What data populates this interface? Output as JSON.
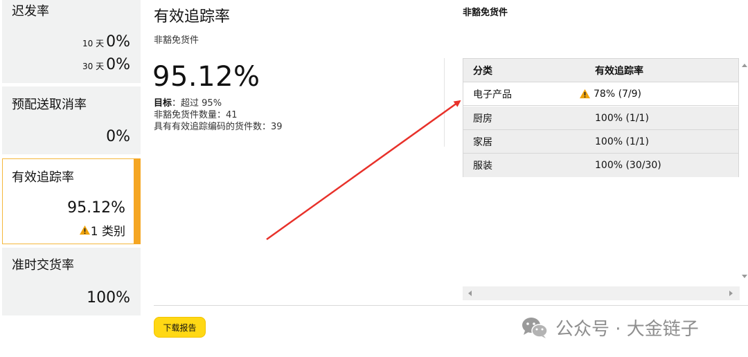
{
  "sidebar": {
    "late_dispatch": {
      "title": "迟发率",
      "d10_label": "10 天",
      "d10_value": "0%",
      "d30_label": "30 天",
      "d30_value": "0%"
    },
    "precancel": {
      "title": "预配送取消率",
      "value": "0%"
    },
    "valid_tracking": {
      "title": "有效追踪率",
      "value": "95.12%",
      "warning": "1 类别"
    },
    "on_time": {
      "title": "准时交货率",
      "value": "100%"
    }
  },
  "main": {
    "title": "有效追踪率",
    "subtitle": "非豁免货件",
    "big_value": "95.12%",
    "target_label": "目标",
    "target_value": "：超过 95%",
    "nonexempt_line": "非豁免货件数量：41",
    "tracked_line": "具有有效追踪编码的货件数：39"
  },
  "table": {
    "title": "非豁免货件",
    "headers": [
      "分类",
      "有效追踪率"
    ],
    "rows": [
      {
        "category": "电子产品",
        "rate": "78% (7/9)"
      },
      {
        "category": "厨房",
        "rate": "100% (1/1)"
      },
      {
        "category": "家居",
        "rate": "100% (1/1)"
      },
      {
        "category": "服装",
        "rate": "100% (30/30)"
      }
    ]
  },
  "download_label": "下载报告",
  "watermark": "公众号 · 大金链子",
  "colors": {
    "accent": "#f5a623",
    "warning": "#f0a30a",
    "button": "#ffd814",
    "annotation_arrow": "#e8312a"
  }
}
